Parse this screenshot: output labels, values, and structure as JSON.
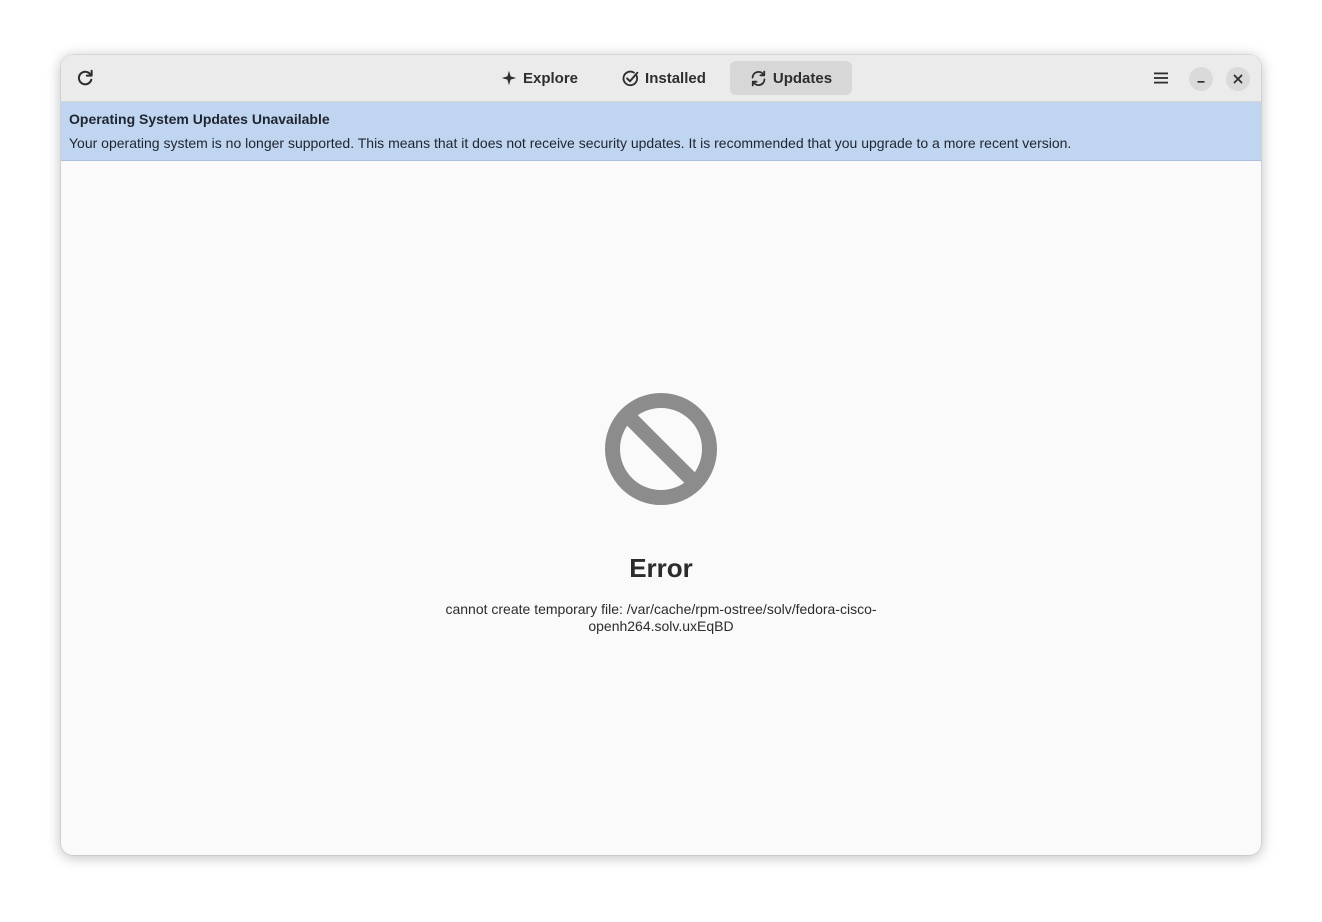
{
  "header": {
    "refresh_icon": "view-refresh-icon",
    "tabs": [
      {
        "label": "Explore",
        "icon": "explore-sparkle-icon",
        "active": false
      },
      {
        "label": "Installed",
        "icon": "check-circle-icon",
        "active": false
      },
      {
        "label": "Updates",
        "icon": "sync-arrows-icon",
        "active": true
      }
    ],
    "menu_icon": "hamburger-menu-icon",
    "minimize_icon": "minimize-icon",
    "close_icon": "close-icon"
  },
  "banner": {
    "title": "Operating System Updates Unavailable",
    "text": "Your operating system is no longer supported. This means that it does not receive security updates. It is recommended that you upgrade to a more recent version.",
    "color": "#c0d5f0"
  },
  "status": {
    "icon": "no-entry-icon",
    "title": "Error",
    "description_line1": "cannot create temporary file: /var/cache/rpm-ostree/solv/fedora-cisco-",
    "description_line2": "openh264.solv.uxEqBD"
  },
  "colors": {
    "headerbar": "#ebebeb",
    "active_tab": "#d7d7d7",
    "icon_gray": "#8c8c8c"
  }
}
